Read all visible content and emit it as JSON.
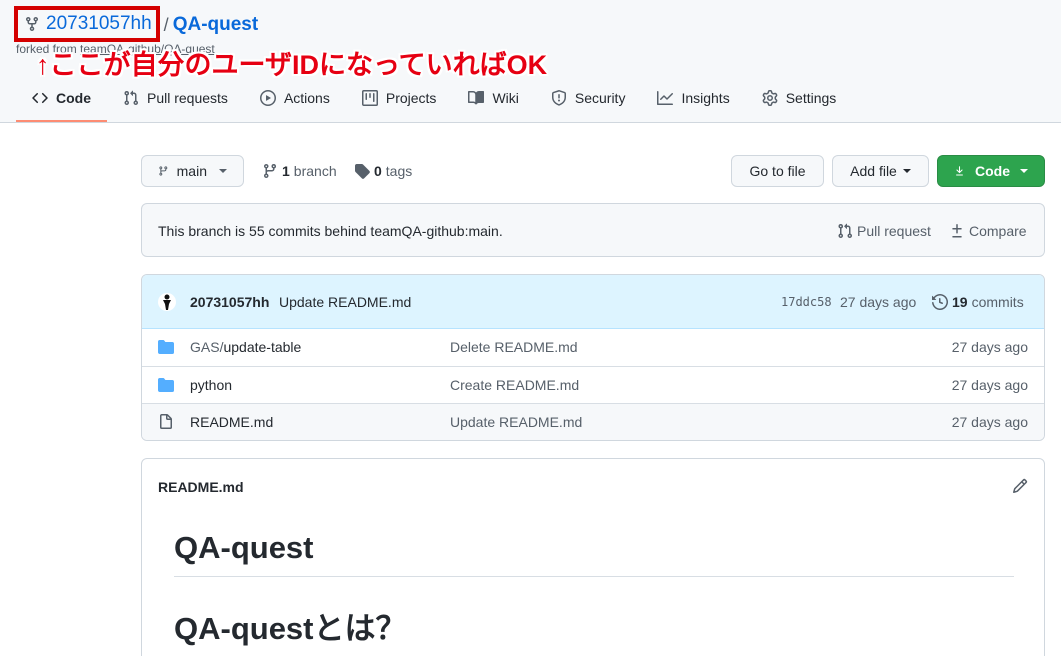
{
  "repo": {
    "owner": "20731057hh",
    "separator": "/",
    "name": "QA-quest",
    "forked_prefix": "forked from ",
    "forked_source": "teamQA-github/QA-quest"
  },
  "annotation": "↑ここが自分のユーザIDになっていればOK",
  "tabs": [
    {
      "label": "Code",
      "icon": "code-icon"
    },
    {
      "label": "Pull requests",
      "icon": "pull-request-icon"
    },
    {
      "label": "Actions",
      "icon": "play-icon"
    },
    {
      "label": "Projects",
      "icon": "project-icon"
    },
    {
      "label": "Wiki",
      "icon": "book-icon"
    },
    {
      "label": "Security",
      "icon": "shield-icon"
    },
    {
      "label": "Insights",
      "icon": "graph-icon"
    },
    {
      "label": "Settings",
      "icon": "gear-icon"
    }
  ],
  "toolbar": {
    "branch": "main",
    "branch_count": "1",
    "branch_label": "branch",
    "tag_count": "0",
    "tag_label": "tags",
    "go_to_file": "Go to file",
    "add_file": "Add file",
    "code": "Code"
  },
  "behind": {
    "message": "This branch is 55 commits behind teamQA-github:main.",
    "pull_request": "Pull request",
    "compare": "Compare"
  },
  "latest_commit": {
    "author": "20731057hh",
    "message": "Update README.md",
    "sha": "17ddc58",
    "age": "27 days ago",
    "commit_count": "19",
    "commit_label": "commits"
  },
  "files": [
    {
      "type": "dir",
      "dim": "GAS/",
      "name": "update-table",
      "message": "Delete README.md",
      "age": "27 days ago"
    },
    {
      "type": "dir",
      "dim": "",
      "name": "python",
      "message": "Create README.md",
      "age": "27 days ago"
    },
    {
      "type": "file",
      "dim": "",
      "name": "README.md",
      "message": "Update README.md",
      "age": "27 days ago"
    }
  ],
  "readme": {
    "filename": "README.md",
    "h1": "QA-quest",
    "h2": "QA-questとは？"
  },
  "colors": {
    "link": "#0969da",
    "annotation": "#e60012",
    "green_button": "#2da44e",
    "folder": "#54aeff"
  }
}
